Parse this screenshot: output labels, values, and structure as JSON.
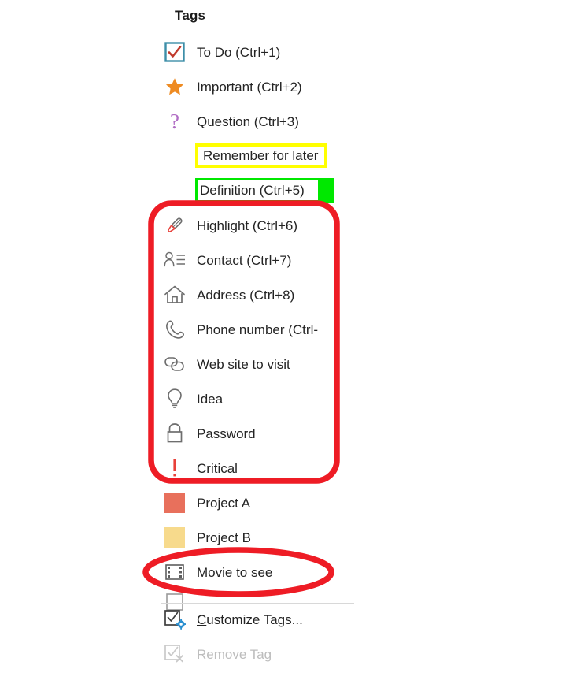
{
  "menu": {
    "title": "Tags",
    "items": [
      {
        "label": "To Do (Ctrl+1)",
        "icon": "checkbox-checked-icon",
        "kind": "icon",
        "state": "enabled"
      },
      {
        "label": "Important (Ctrl+2)",
        "icon": "star-icon",
        "kind": "icon",
        "state": "enabled"
      },
      {
        "label": "Question (Ctrl+3)",
        "icon": "question-mark-icon",
        "kind": "icon",
        "state": "enabled"
      },
      {
        "label": "Remember for later",
        "icon": "highlight-yellow-icon",
        "kind": "highlight-yellow",
        "state": "enabled"
      },
      {
        "label": "Definition (Ctrl+5)",
        "icon": "highlight-green-icon",
        "kind": "highlight-green",
        "state": "enabled"
      },
      {
        "label": "Highlight (Ctrl+6)",
        "icon": "pen-icon",
        "kind": "icon",
        "state": "enabled"
      },
      {
        "label": "Contact (Ctrl+7)",
        "icon": "contact-person-icon",
        "kind": "icon",
        "state": "enabled"
      },
      {
        "label": "Address (Ctrl+8)",
        "icon": "house-icon",
        "kind": "icon",
        "state": "enabled"
      },
      {
        "label": "Phone number (Ctrl-",
        "icon": "phone-icon",
        "kind": "icon",
        "state": "enabled"
      },
      {
        "label": "Web site to visit",
        "icon": "link-icon",
        "kind": "icon",
        "state": "enabled"
      },
      {
        "label": "Idea",
        "icon": "lightbulb-icon",
        "kind": "icon",
        "state": "enabled"
      },
      {
        "label": "Password",
        "icon": "padlock-icon",
        "kind": "icon",
        "state": "enabled"
      },
      {
        "label": "Critical",
        "icon": "exclamation-icon",
        "kind": "icon",
        "state": "enabled"
      },
      {
        "label": "Project A",
        "icon": "color-swatch-icon",
        "kind": "swatch",
        "state": "enabled",
        "swatch_color": "#E8705C"
      },
      {
        "label": "Project B",
        "icon": "color-swatch-icon",
        "kind": "swatch",
        "state": "enabled",
        "swatch_color": "#F7DA8C"
      },
      {
        "label": "Movie to see",
        "icon": "film-strip-icon",
        "kind": "icon",
        "state": "enabled"
      }
    ],
    "footer_items": [
      {
        "label_prefix": "C",
        "label_rest": "ustomize Tags...",
        "icon": "customize-tags-icon",
        "state": "enabled"
      },
      {
        "label": "Remove Tag",
        "icon": "remove-tag-icon",
        "state": "disabled"
      }
    ]
  },
  "colors": {
    "annotation_red": "#EE1C25",
    "highlight_yellow": "#FFFF00",
    "highlight_green": "#00E800",
    "project_a": "#E8705C",
    "project_b": "#F7DA8C",
    "text": "#242424",
    "disabled_text": "#BDBDBD",
    "star_orange": "#EE8B22",
    "question_purple": "#B06CC4",
    "checkbox_border": "#3D8EA8",
    "check_red": "#C0392B",
    "critical_red": "#E8413A",
    "icon_grey": "#6E6E6E"
  },
  "annotations": [
    {
      "name": "red-rounded-rect-tag-group",
      "shape": "rounded-rect",
      "covers": "Highlight (Ctrl+6) through Critical"
    },
    {
      "name": "red-oval-movie-to-see",
      "shape": "ellipse",
      "covers": "Movie to see"
    }
  ]
}
